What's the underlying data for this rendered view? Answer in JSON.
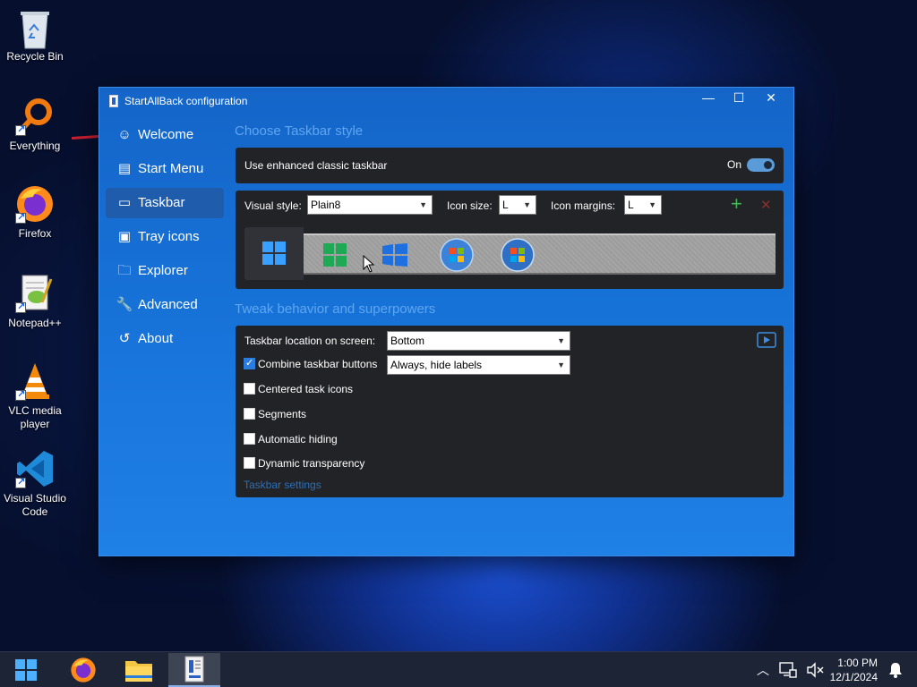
{
  "desktop": {
    "icons": [
      {
        "label": "Recycle Bin",
        "icon": "recycle-bin-icon"
      },
      {
        "label": "Everything",
        "icon": "everything-search-icon"
      },
      {
        "label": "Firefox",
        "icon": "firefox-icon"
      },
      {
        "label": "Notepad++",
        "icon": "notepadpp-icon"
      },
      {
        "label": "VLC media player",
        "icon": "vlc-icon"
      },
      {
        "label": "Visual Studio Code",
        "icon": "vscode-icon"
      }
    ]
  },
  "window": {
    "title": "StartAllBack configuration",
    "controls": {
      "minimize": "—",
      "maximize": "☐",
      "close": "✕"
    },
    "nav": [
      {
        "label": "Welcome",
        "icon": "smiley-icon",
        "glyph": "☺"
      },
      {
        "label": "Start Menu",
        "icon": "start-menu-icon",
        "glyph": "▤"
      },
      {
        "label": "Taskbar",
        "icon": "taskbar-icon",
        "glyph": "▭",
        "active": true
      },
      {
        "label": "Tray icons",
        "icon": "tray-icon",
        "glyph": "▣"
      },
      {
        "label": "Explorer",
        "icon": "folder-icon",
        "glyph": "🗀"
      },
      {
        "label": "Advanced",
        "icon": "wrench-icon",
        "glyph": "🔧"
      },
      {
        "label": "About",
        "icon": "about-icon",
        "glyph": "↺"
      }
    ],
    "section1_title": "Choose Taskbar style",
    "enhanced": {
      "label": "Use enhanced classic taskbar",
      "state_label": "On",
      "enabled": true
    },
    "style": {
      "visual_style_label": "Visual style:",
      "visual_style_value": "Plain8",
      "icon_size_label": "Icon size:",
      "icon_size_value": "L",
      "icon_margins_label": "Icon margins:",
      "icon_margins_value": "L",
      "add_glyph": "+",
      "remove_glyph": "✕"
    },
    "section2_title": "Tweak behavior and superpowers",
    "location": {
      "label": "Taskbar location on screen:",
      "value": "Bottom"
    },
    "combine": {
      "label": "Combine taskbar buttons",
      "value": "Always, hide labels",
      "checked": true
    },
    "checkboxes": [
      {
        "label": "Centered task icons",
        "checked": false
      },
      {
        "label": "Segments",
        "checked": false
      },
      {
        "label": "Automatic hiding",
        "checked": false
      },
      {
        "label": "Dynamic transparency",
        "checked": false
      }
    ],
    "settings_link": "Taskbar settings"
  },
  "taskbar": {
    "clock_time": "1:00 PM",
    "clock_date": "12/1/2024"
  },
  "colors": {
    "accent": "#2a7ddc",
    "section_title": "#5fa6f0",
    "panel": "#222326"
  }
}
